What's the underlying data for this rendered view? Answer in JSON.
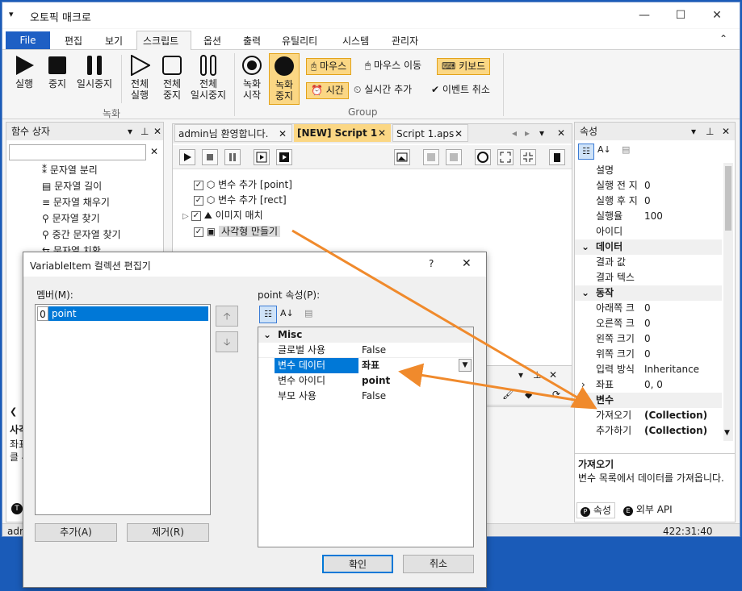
{
  "app": {
    "title": "오토픽 매크로",
    "title_icon": "▾",
    "win_min": "—",
    "win_max": "☐",
    "win_close": "✕"
  },
  "menu": {
    "file": "File",
    "items": [
      "편집",
      "보기",
      "스크립트",
      "옵션",
      "출력",
      "유틸리티",
      "시스템",
      "관리자"
    ],
    "collapse": "⌃"
  },
  "ribbon": {
    "run": "실행",
    "stop": "중지",
    "pause": "일시중지",
    "run_all_1": "전체",
    "run_all_2": "실행",
    "stop_all_1": "전체",
    "stop_all_2": "중지",
    "pause_all_1": "전체",
    "pause_all_2": "일시중지",
    "rec_start_1": "녹화",
    "rec_start_2": "시작",
    "rec_stop_1": "녹화",
    "rec_stop_2": "중지",
    "group_record": "녹화",
    "group_group": "Group",
    "mouse": "마우스",
    "mouse_move": "마우스 이동",
    "keyboard": "키보드",
    "time": "시간",
    "realtime_add": "실시간 추가",
    "event_cancel": "이벤트 취소"
  },
  "func_panel": {
    "title": "함수 상자",
    "search_placeholder": "",
    "items": [
      "문자열 분리",
      "문자열 길이",
      "문자열 채우기",
      "문자열 찾기",
      "중간 문자열 찾기",
      "문자열 치환"
    ],
    "bottom_title": "사각",
    "bottom_l1": "좌표",
    "bottom_l2": "클 4"
  },
  "tabs": {
    "t1": "admin님 환영합니다.",
    "t2": "[NEW] Script 1",
    "t3": "Script 1.aps"
  },
  "script": {
    "items": [
      "변수 추가 [point]",
      "변수 추가 [rect]",
      "이미지 매치",
      "사각형 만들기"
    ]
  },
  "props": {
    "title": "속성",
    "rows": [
      {
        "k": "설명",
        "v": ""
      },
      {
        "k": "실행 전 지",
        "v": "0"
      },
      {
        "k": "실행 후 지",
        "v": "0"
      },
      {
        "k": "실행율",
        "v": "100"
      },
      {
        "k": "아이디",
        "v": ""
      }
    ],
    "cat_data": "데이터",
    "data_rows": [
      {
        "k": "결과 값",
        "v": ""
      },
      {
        "k": "결과 텍스",
        "v": ""
      }
    ],
    "cat_action": "동작",
    "action_rows": [
      {
        "k": "아래쪽 크",
        "v": "0"
      },
      {
        "k": "오른쪽 크",
        "v": "0"
      },
      {
        "k": "왼쪽 크기",
        "v": "0"
      },
      {
        "k": "위쪽 크기",
        "v": "0"
      },
      {
        "k": "입력 방식",
        "v": "Inheritance"
      },
      {
        "k": "좌표",
        "v": "0, 0"
      }
    ],
    "cat_var": "변수",
    "var_rows": [
      {
        "k": "가져오기",
        "v": "(Collection)"
      },
      {
        "k": "추가하기",
        "v": "(Collection)"
      }
    ],
    "desc_title": "가져오기",
    "desc_text": "변수 목록에서 데이터를 가져옵니다.",
    "tab_props": "속성",
    "tab_api": "외부 API"
  },
  "status": {
    "left": "adm",
    "right": "422:31:40"
  },
  "dialog": {
    "title": "VariableItem 컬렉션 편집기",
    "help": "?",
    "close": "✕",
    "members_label": "멤버(M):",
    "member_index": "0",
    "member_name": "point",
    "props_label": "point 속성(P):",
    "category": "Misc",
    "rows": [
      {
        "k": "글로벌 사용",
        "v": "False"
      },
      {
        "k": "변수 데이터",
        "v": "좌표"
      },
      {
        "k": "변수 아이디",
        "v": "point"
      },
      {
        "k": "부모 사용",
        "v": "False"
      }
    ],
    "add": "추가(A)",
    "remove": "제거(R)",
    "ok": "확인",
    "cancel": "취소"
  },
  "colors": {
    "accent": "#1e5fc4",
    "highlight": "#fbd784",
    "arrow": "#f08a2c",
    "selection": "#0078d7"
  }
}
